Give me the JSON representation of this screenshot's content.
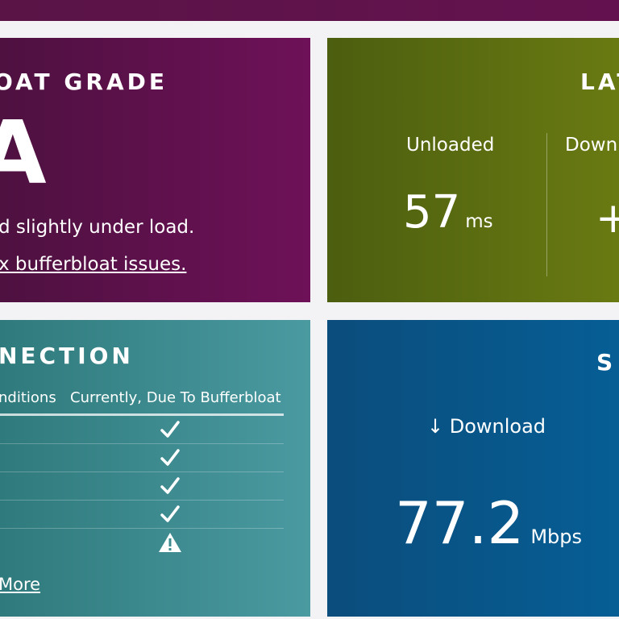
{
  "grade": {
    "title": "OAT GRADE",
    "letter": "A",
    "description": "d slightly under load.",
    "link": "x bufferbloat issues."
  },
  "latency": {
    "title": "LAT",
    "unloaded_label": "Unloaded",
    "down_label": "Down",
    "unloaded_value": "57",
    "unit": "ms",
    "down_value_partial": "+"
  },
  "connection": {
    "title": "NECTION",
    "col1": "nditions",
    "col2": "Currently, Due To Bufferbloat",
    "rows": [
      {
        "status": "check",
        "icon": "check-icon"
      },
      {
        "status": "check",
        "icon": "check-icon"
      },
      {
        "status": "check",
        "icon": "check-icon"
      },
      {
        "status": "check",
        "icon": "check-icon"
      },
      {
        "status": "warning",
        "icon": "warning-icon"
      }
    ],
    "link": "More"
  },
  "speed": {
    "title": "S",
    "label": "↓ Download",
    "value": "77.2",
    "unit": "Mbps"
  }
}
